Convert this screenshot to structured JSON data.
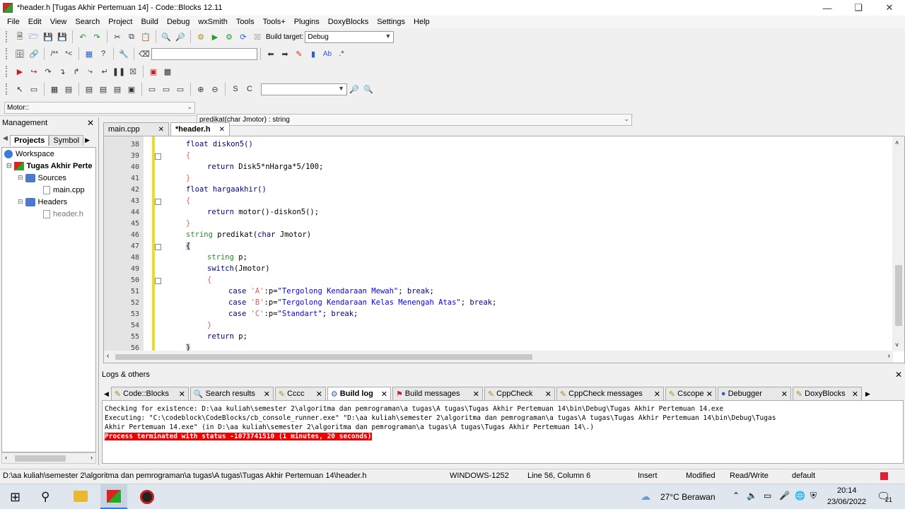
{
  "window": {
    "title": "*header.h [Tugas Akhir Pertemuan 14] - Code::Blocks 12.11"
  },
  "menu": [
    "File",
    "Edit",
    "View",
    "Search",
    "Project",
    "Build",
    "Debug",
    "wxSmith",
    "Tools",
    "Tools+",
    "Plugins",
    "DoxyBlocks",
    "Settings",
    "Help"
  ],
  "toolbar": {
    "build_target_label": "Build target:",
    "build_target_value": "Debug"
  },
  "scope": {
    "class": "Motor::",
    "function": "predikat(char Jmotor) : string"
  },
  "management": {
    "title": "Management",
    "tabs": [
      "Projects",
      "Symbol"
    ],
    "tree": {
      "workspace": "Workspace",
      "project": "Tugas Akhir Perte",
      "sources": "Sources",
      "main": "main.cpp",
      "headers": "Headers",
      "header": "header.h"
    }
  },
  "editor": {
    "tabs": [
      "main.cpp",
      "*header.h"
    ],
    "lines": [
      "38",
      "39",
      "40",
      "41",
      "42",
      "43",
      "44",
      "45",
      "46",
      "47",
      "48",
      "49",
      "50",
      "51",
      "52",
      "53",
      "54",
      "55",
      "56"
    ],
    "code": {
      "l38": "float diskon5()",
      "l39": "{",
      "l40a": "return ",
      "l40b": "Disk5*nHarga*5/100;",
      "l41": "}",
      "l42": "float hargaakhir()",
      "l43": "{",
      "l44a": "return ",
      "l44b": "motor()-diskon5();",
      "l45": "}",
      "l46a": "string ",
      "l46b": "predikat(",
      "l46c": "char ",
      "l46d": "Jmotor)",
      "l47": "{",
      "l48a": "string ",
      "l48b": "p;",
      "l49a": "switch",
      "l49b": "(Jmotor)",
      "l50": "{",
      "l51a": "case ",
      "l51b": "'A'",
      "l51c": ":p=",
      "l51d": "\"Tergolong Kendaraan Mewah\"",
      "l51e": "; ",
      "l51f": "break",
      "l51g": ";",
      "l52a": "case ",
      "l52b": "'B'",
      "l52c": ":p=",
      "l52d": "\"Tergolong Kendaraan Kelas Menengah Atas\"",
      "l52e": "; ",
      "l52f": "break",
      "l52g": ";",
      "l53a": "case ",
      "l53b": "'C'",
      "l53c": ":p=",
      "l53d": "\"Standart\"",
      "l53e": "; ",
      "l53f": "break",
      "l53g": ";",
      "l54": "}",
      "l55a": "return ",
      "l55b": "p;",
      "l56": "}"
    }
  },
  "logs": {
    "title": "Logs & others",
    "tabs": [
      "Code::Blocks",
      "Search results",
      "Cccc",
      "Build log",
      "Build messages",
      "CppCheck",
      "CppCheck messages",
      "Cscope",
      "Debugger",
      "DoxyBlocks"
    ],
    "line1": "Checking for existence: D:\\aa kuliah\\semester 2\\algoritma dan pemrograman\\a tugas\\A tugas\\Tugas Akhir Pertemuan 14\\bin\\Debug\\Tugas Akhir Pertemuan 14.exe",
    "line2": "Executing: \"C:\\codeblock\\CodeBlocks/cb_console_runner.exe\" \"D:\\aa kuliah\\semester 2\\algoritma dan pemrograman\\a tugas\\A tugas\\Tugas Akhir Pertemuan 14\\bin\\Debug\\Tugas",
    "line3": "Akhir Pertemuan 14.exe\"  (in D:\\aa kuliah\\semester 2\\algoritma dan pemrograman\\a tugas\\A tugas\\Tugas Akhir Pertemuan 14\\.)",
    "line4": "Process terminated with status -1073741510 (1 minutes, 20 seconds)"
  },
  "status": {
    "path": "D:\\aa kuliah\\semester 2\\algoritma dan pemrograman\\a tugas\\A tugas\\Tugas Akhir Pertemuan 14\\header.h",
    "encoding": "WINDOWS-1252",
    "position": "Line 56, Column 6",
    "mode": "Insert",
    "modified": "Modified",
    "rw": "Read/Write",
    "lang": "default"
  },
  "taskbar": {
    "weather": "27°C Berawan",
    "time": "20:14",
    "date": "23/06/2022",
    "notif": "21"
  }
}
